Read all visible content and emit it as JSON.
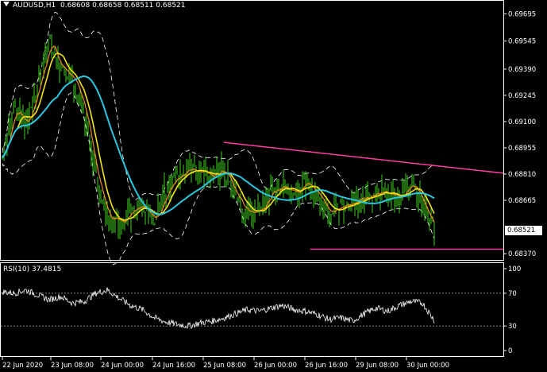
{
  "header": {
    "symbol": "AUDUSD,H1",
    "open": "0.68608",
    "high": "0.68658",
    "low": "0.68511",
    "close": "0.68521"
  },
  "price_axis": {
    "labels": [
      "0.69695",
      "0.69545",
      "0.69390",
      "0.69245",
      "0.69100",
      "0.68955",
      "0.68810",
      "0.68665",
      "0.68370"
    ],
    "values": [
      0.69695,
      0.69545,
      0.6939,
      0.69245,
      0.691,
      0.68955,
      0.6881,
      0.68665,
      0.6837
    ],
    "current_price": "0.68521",
    "current_value": 0.68521
  },
  "rsi": {
    "label": "RSI(10) 37.4815",
    "axis_labels": [
      "100",
      "70",
      "30",
      "0"
    ],
    "axis_values": [
      100,
      70,
      30,
      0
    ],
    "levels": [
      70,
      30
    ]
  },
  "time_axis": {
    "labels": [
      "22 Jun 2020",
      "23 Jun 08:00",
      "24 Jun 00:00",
      "24 Jun 16:00",
      "25 Jun 08:00",
      "26 Jun 00:00",
      "26 Jun 16:00",
      "29 Jun 08:00",
      "30 Jun 00:00"
    ]
  },
  "colors": {
    "background": "#000000",
    "candles": "#3ecf1e",
    "ma_fast": "#f08a18",
    "ma_mid": "#f5e416",
    "ma_slow": "#29c8e0",
    "bands": "#ffffff",
    "trendline": "#ff3ea5",
    "rsi_line": "#ffffff",
    "grid_axis": "#ffffff"
  },
  "chart_data": {
    "type": "line",
    "series": [
      {
        "name": "price",
        "x": [
          0,
          4,
          8,
          12,
          16,
          20,
          24,
          28,
          32,
          36,
          40,
          44,
          48,
          52,
          56,
          60,
          64,
          68,
          72,
          76,
          80,
          84,
          88,
          92,
          96,
          100,
          104,
          108,
          112,
          116,
          120,
          124,
          128,
          132,
          136,
          140,
          144,
          148
        ],
        "values": [
          0.689,
          0.6918,
          0.6908,
          0.693,
          0.6955,
          0.6938,
          0.6935,
          0.6915,
          0.688,
          0.6858,
          0.6855,
          0.686,
          0.6862,
          0.6855,
          0.6872,
          0.688,
          0.6885,
          0.6882,
          0.688,
          0.6883,
          0.6868,
          0.686,
          0.6862,
          0.687,
          0.6875,
          0.6872,
          0.6876,
          0.687,
          0.686,
          0.6862,
          0.6866,
          0.6868,
          0.6872,
          0.687,
          0.6868,
          0.6875,
          0.6865,
          0.68521
        ]
      }
    ],
    "trendlines": [
      {
        "from": [
          0.68985
        ],
        "to": [
          0.68815
        ]
      },
      {
        "level": 0.68395
      }
    ],
    "rsi_values": [
      72,
      70,
      74,
      68,
      62,
      66,
      58,
      60,
      70,
      74,
      64,
      55,
      50,
      40,
      35,
      32,
      30,
      34,
      36,
      40,
      45,
      50,
      48,
      52,
      55,
      50,
      48,
      44,
      38,
      40,
      36,
      45,
      52,
      48,
      55,
      60,
      58,
      37
    ]
  }
}
